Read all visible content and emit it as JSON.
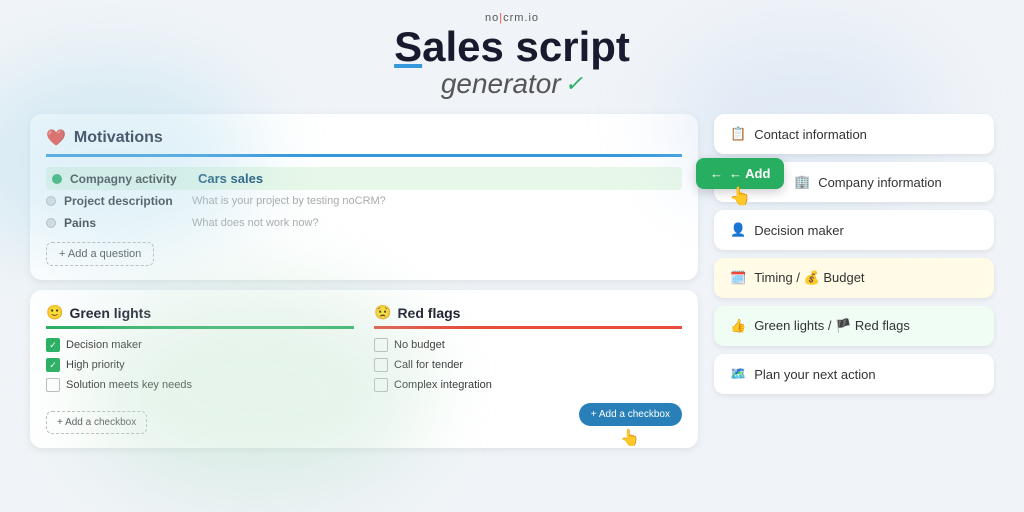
{
  "header": {
    "logo": "no|crm.io",
    "title_line1": "Sales script",
    "title_line2": "generator",
    "checkmark": "✓"
  },
  "motivations": {
    "title": "Motivations",
    "icon": "❤️",
    "questions": [
      {
        "label": "Compagny activity",
        "value": "Cars sales",
        "active": true,
        "placeholder": ""
      },
      {
        "label": "Project description",
        "value": "",
        "active": false,
        "placeholder": "What is your project by testing noCRM?"
      },
      {
        "label": "Pains",
        "value": "",
        "active": false,
        "placeholder": "What does not work now?"
      }
    ],
    "add_button": "+ Add a question"
  },
  "green_lights": {
    "title": "Green lights",
    "icon": "🙂",
    "items": [
      {
        "label": "Decision maker",
        "checked": true
      },
      {
        "label": "High priority",
        "checked": true
      },
      {
        "label": "Solution meets key needs",
        "checked": false
      }
    ],
    "add_button": "+ Add a checkbox"
  },
  "red_flags": {
    "title": "Red flags",
    "icon": "😟",
    "items": [
      {
        "label": "No budget",
        "checked": false
      },
      {
        "label": "Call for tender",
        "checked": false
      },
      {
        "label": "Complex integration",
        "checked": false
      }
    ],
    "add_button": "+ Add a checkbox"
  },
  "right_panel": {
    "items": [
      {
        "icon": "📋",
        "label": "Contact information"
      },
      {
        "icon": "🏢",
        "label": "Company information"
      },
      {
        "icon": "👤",
        "label": "Decision maker"
      },
      {
        "icon": "🗓️",
        "label": "Timing / 💰 Budget"
      },
      {
        "icon": "👍",
        "label": "Green lights / 🏴 Red flags"
      },
      {
        "icon": "🗺️",
        "label": "Plan your next action"
      }
    ],
    "add_button": "← Add"
  }
}
